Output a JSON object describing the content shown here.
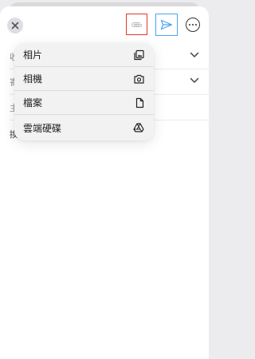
{
  "toolbar": {
    "close_icon": "close-icon",
    "attach_icon": "paperclip-icon",
    "send_icon": "send-icon",
    "more_icon": "ellipsis-circle-icon"
  },
  "form": {
    "fields": [
      {
        "label": "收"
      },
      {
        "label": "寄"
      },
      {
        "label": "主"
      }
    ],
    "body_text": "換行 區行"
  },
  "attach_menu": {
    "items": [
      {
        "label": "相片",
        "icon": "photo-library-icon"
      },
      {
        "label": "相機",
        "icon": "camera-icon"
      },
      {
        "label": "檔案",
        "icon": "file-icon"
      },
      {
        "label": "雲端硬碟",
        "icon": "google-drive-icon"
      }
    ]
  },
  "colors": {
    "attach_highlight": "#e5372c",
    "send_highlight": "#4aa3f2",
    "send_icon": "#4aa3f2"
  }
}
